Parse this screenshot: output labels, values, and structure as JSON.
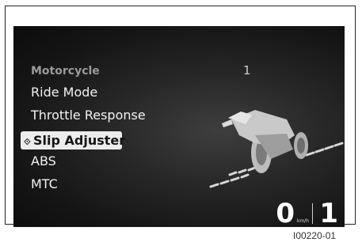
{
  "menu": {
    "header": "Motorcycle",
    "header_value": "1",
    "items": [
      {
        "label": "Ride Mode"
      },
      {
        "label": "Throttle Response"
      },
      {
        "label": "Slip Adjuster",
        "selected": true
      },
      {
        "label": "ABS"
      },
      {
        "label": "MTC"
      }
    ]
  },
  "status": {
    "speed": "0",
    "speed_unit": "km/h",
    "gear": "1"
  },
  "caption": "I00220-01"
}
